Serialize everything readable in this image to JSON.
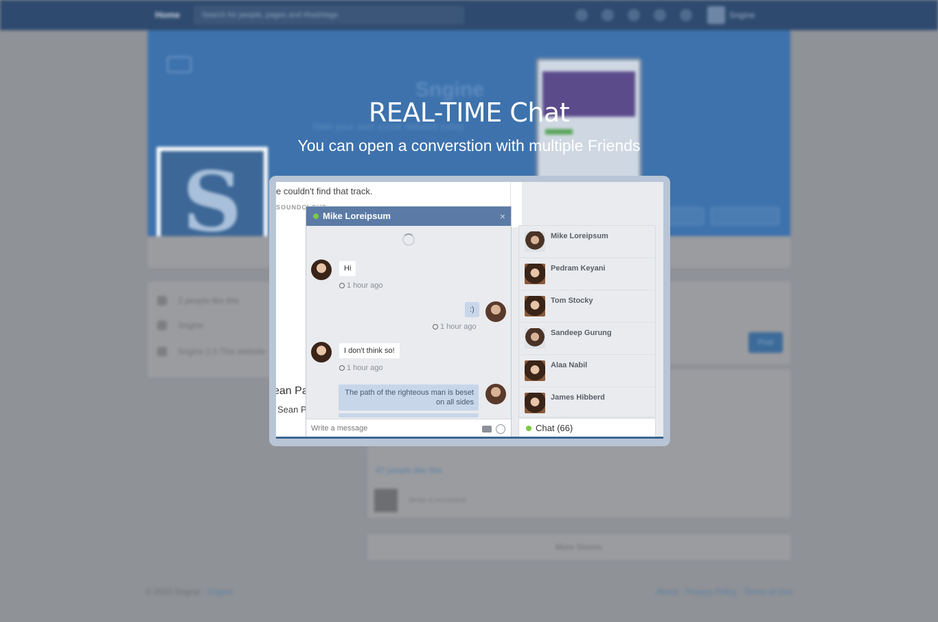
{
  "overlay": {
    "title": "REAL-TIME Chat",
    "subtitle": "You can open a converstion with multiple Friends"
  },
  "background": {
    "brand": "Home",
    "search_placeholder": "Search for people, pages and #hashtags",
    "user_name": "Sngine",
    "page_title": "Sngine",
    "page_subtitle": "Start your own social network today",
    "left_items": [
      "2 people like this",
      "Sngine",
      "Sngine 2.0 This website · info@sngine.com"
    ],
    "post_button": "Post",
    "likes_text": "47 people like this",
    "comment_placeholder": "Write a comment",
    "more_stories": "More Stories",
    "footer_copyright": "© 2015 Sngine",
    "footer_brand": "Sngine",
    "footer_links": "About · Privacy Policy · Terms of Use"
  },
  "feed": {
    "track_text": "e couldn't find that track.",
    "soundcloud": "SOUNDCLOUD",
    "name_partial": "ean Pa",
    "name_partial2": "Sean P"
  },
  "chat": {
    "contact_name": "Mike Loreipsum",
    "close_glyph": "×",
    "messages": [
      {
        "dir": "in",
        "text": "Hi",
        "time": "1 hour ago"
      },
      {
        "dir": "out",
        "text": ":)",
        "time": "1 hour ago"
      },
      {
        "dir": "in",
        "text": "I don't think so!",
        "time": "1 hour ago"
      },
      {
        "dir": "out",
        "text": "The path of the righteous man is beset on all sides"
      }
    ],
    "input_placeholder": "Write a message",
    "icons": {
      "camera": "camera-icon",
      "emoji": "smiley-icon",
      "status": "online-dot-icon"
    },
    "online_color": "#7ac943",
    "header_color": "#5b7ba6"
  },
  "contacts": {
    "items": [
      {
        "name": "Mike Loreipsum",
        "avatar": "male"
      },
      {
        "name": "Pedram Keyani",
        "avatar": "female"
      },
      {
        "name": "Tom Stocky",
        "avatar": "female"
      },
      {
        "name": "Sandeep Gurung",
        "avatar": "male"
      },
      {
        "name": "Alaa Nabil",
        "avatar": "female"
      },
      {
        "name": "James Hibberd",
        "avatar": "female"
      }
    ],
    "chat_label": "Chat (66)"
  }
}
